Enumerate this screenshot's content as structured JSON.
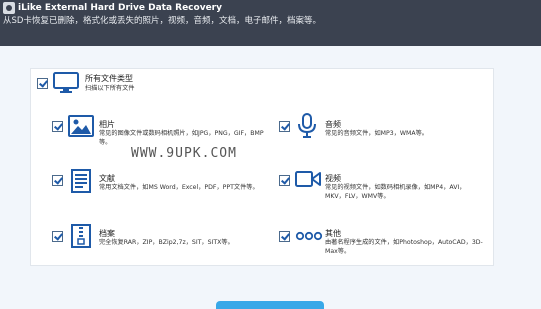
{
  "window": {
    "title": "iLike External Hard Drive Data Recovery",
    "subtitle": "从SD卡恢复已删除，格式化或丢失的照片，视频，音频，文档，电子邮件，档案等。"
  },
  "all_types": {
    "title": "所有文件类型",
    "desc": "扫描以下所有文件",
    "checked": true
  },
  "items": [
    {
      "title": "相片",
      "desc": "常见的图像文件或数码相机照片，如JPG，PNG，GIF，BMP等。",
      "icon": "image-icon",
      "checked": true
    },
    {
      "title": "音频",
      "desc": "常见的音频文件，如MP3，WMA等。",
      "icon": "microphone-icon",
      "checked": true
    },
    {
      "title": "文献",
      "desc": "常用文档文件，如MS Word，Excel，PDF，PPT文件等。",
      "icon": "document-icon",
      "checked": true
    },
    {
      "title": "视频",
      "desc": "常见的视频文件，如数码相机录像，如MP4，AVI，MKV，FLV，WMV等。",
      "icon": "video-camera-icon",
      "checked": true
    },
    {
      "title": "档案",
      "desc": "完全恢复RAR，ZIP，BZip2,7z，SIT，SITX等。",
      "icon": "archive-icon",
      "checked": true
    },
    {
      "title": "其他",
      "desc": "由著名程序生成的文件，如Photoshop，AutoCAD，3D-Max等。",
      "icon": "more-icon",
      "checked": true
    }
  ],
  "watermark": "WWW.9UPK.COM",
  "colors": {
    "titlebar": "#3b4250",
    "accent": "#1e5aa8",
    "button": "#38a8e8"
  }
}
